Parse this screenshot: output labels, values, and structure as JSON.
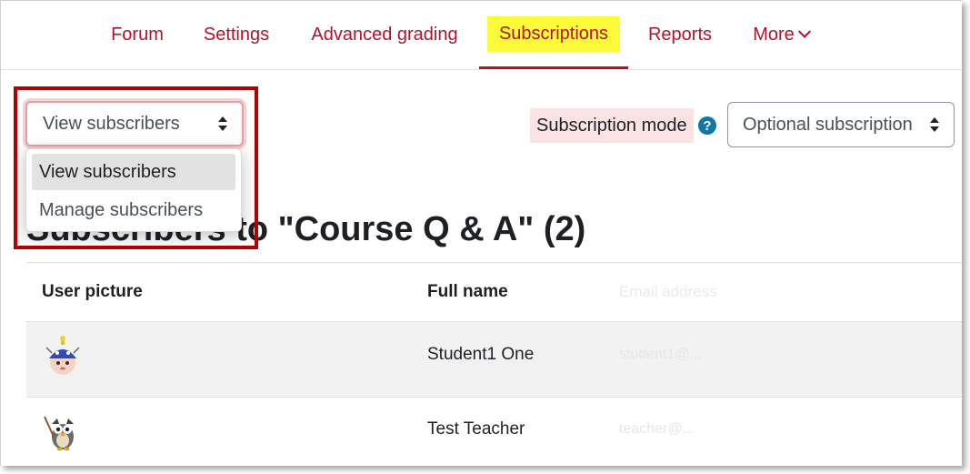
{
  "nav": {
    "items": [
      {
        "label": "Forum"
      },
      {
        "label": "Settings"
      },
      {
        "label": "Advanced grading"
      },
      {
        "label": "Subscriptions",
        "active": true
      },
      {
        "label": "Reports"
      },
      {
        "label": "More"
      }
    ]
  },
  "view_select": {
    "value": "View subscribers",
    "options": [
      "View subscribers",
      "Manage subscribers"
    ]
  },
  "subscription_mode": {
    "label": "Subscription mode",
    "help_icon": "?",
    "value": "Optional subscription"
  },
  "heading": "Subscribers to \"Course Q & A\" (2)",
  "table": {
    "headers": [
      "User picture",
      "Full name",
      "Email address"
    ],
    "rows": [
      {
        "full_name": "Student1 One",
        "email": "student1@..."
      },
      {
        "full_name": "Test Teacher",
        "email": "teacher@..."
      }
    ]
  },
  "colors": {
    "nav_text": "#b3142b",
    "highlight": "#fbfb3a",
    "annotation": "#b00000",
    "help_icon": "#1177a7"
  }
}
